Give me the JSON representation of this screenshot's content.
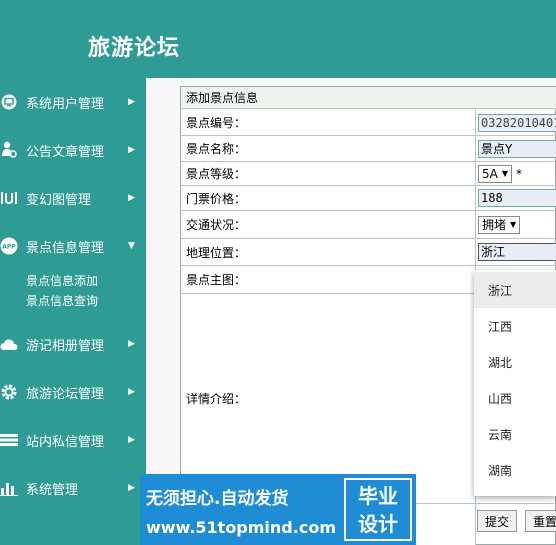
{
  "app": {
    "title": "旅游论坛"
  },
  "sidebar": {
    "items": [
      {
        "label": "系统用户管理",
        "icon": "monitor-icon",
        "arrow": "▶"
      },
      {
        "label": "公告文章管理",
        "icon": "users-gear-icon",
        "arrow": "▶"
      },
      {
        "label": "变幻图管理",
        "icon": "bracket-icon",
        "arrow": "▶"
      },
      {
        "label": "景点信息管理",
        "icon": "app-icon",
        "arrow": "▼"
      },
      {
        "label": "游记相册管理",
        "icon": "cloud-icon",
        "arrow": "▶"
      },
      {
        "label": "旅游论坛管理",
        "icon": "gear-icon",
        "arrow": "▶"
      },
      {
        "label": "站内私信管理",
        "icon": "stack-icon",
        "arrow": "▶"
      },
      {
        "label": "系统管理",
        "icon": "bar-chart-icon",
        "arrow": "▶"
      }
    ],
    "sub_items": [
      "景点信息添加",
      "景点信息查询"
    ]
  },
  "form": {
    "caption": "添加景点信息",
    "fields": {
      "number_label": "景点编号：",
      "number_value": "03282010401",
      "name_label": "景点名称：",
      "name_value": "景点Y",
      "level_label": "景点等级：",
      "level_value": "5A",
      "level_required": "*",
      "price_label": "门票价格：",
      "price_value": "188",
      "traffic_label": "交通状况：",
      "traffic_value": "拥堵",
      "location_label": "地理位置：",
      "location_value": "浙江",
      "image_label": "景点主图：",
      "detail_label": "详情介绍："
    },
    "location_options": [
      "浙江",
      "江西",
      "湖北",
      "山西",
      "云南",
      "湖南"
    ],
    "selected_option": "浙江",
    "submit_label": "提交",
    "reset_label": "重置"
  },
  "watermark": {
    "line1": "无须担心.自动发货",
    "url": "www.51topmind.com",
    "box_line1": "毕业",
    "box_line2": "设计"
  }
}
